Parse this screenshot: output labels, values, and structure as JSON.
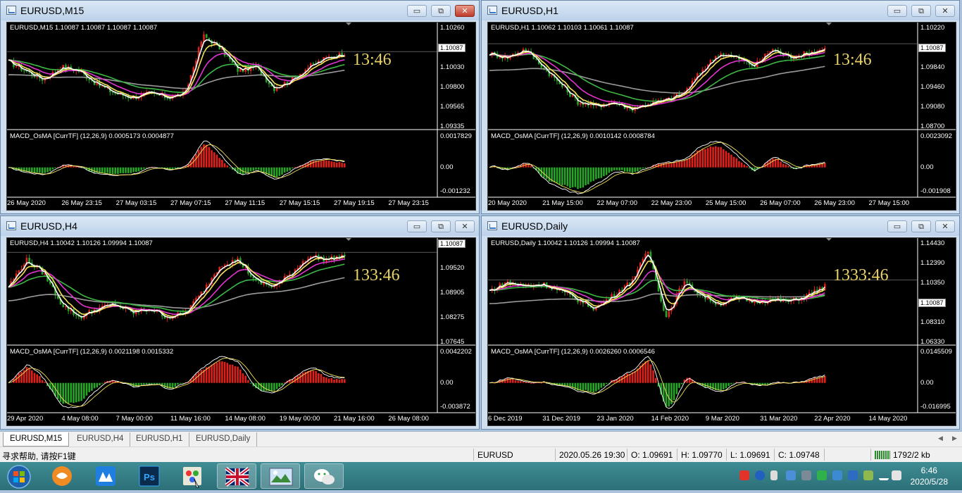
{
  "windows": [
    {
      "title": "EURUSD,M15",
      "ohlc": "EURUSD,M15  1.10087 1.10087 1.10087 1.10087",
      "clock": "13:46",
      "yticks": [
        "1.10260",
        "1.10087",
        "1.10030",
        "1.09800",
        "1.09565",
        "1.09335"
      ],
      "price_tag": "1.10087",
      "macd": "MACD_OsMA [CurrTF] (12,26,9) 0.0005173 0.0004877",
      "macd_ticks": [
        "0.0017829",
        "0.00",
        "-0.001232"
      ],
      "xticks": [
        "26 May 2020",
        "26 May 23:15",
        "27 May 03:15",
        "27 May 07:15",
        "27 May 11:15",
        "27 May 15:15",
        "27 May 19:15",
        "27 May 23:15"
      ]
    },
    {
      "title": "EURUSD,H1",
      "ohlc": "EURUSD,H1  1.10062 1.10103 1.10061 1.10087",
      "clock": "13:46",
      "yticks": [
        "1.10220",
        "1.10087",
        "1.09840",
        "1.09460",
        "1.09080",
        "1.08700"
      ],
      "price_tag": "1.10087",
      "macd": "MACD_OsMA [CurrTF] (12,26,9) 0.0010142 0.0008784",
      "macd_ticks": [
        "0.0023092",
        "0.00",
        "-0.001908"
      ],
      "xticks": [
        "20 May 2020",
        "21 May 15:00",
        "22 May 07:00",
        "22 May 23:00",
        "25 May 15:00",
        "26 May 07:00",
        "26 May 23:00",
        "27 May 15:00"
      ]
    },
    {
      "title": "EURUSD,H4",
      "ohlc": "EURUSD,H4  1.10042 1.10126 1.09994 1.10087",
      "clock": "133:46",
      "yticks": [
        "1.10087",
        "1.09520",
        "1.08905",
        "1.08275",
        "1.07645"
      ],
      "price_tag": "1.10087",
      "macd": "MACD_OsMA [CurrTF] (12,26,9) 0.0021198 0.0015332",
      "macd_ticks": [
        "0.0042202",
        "0.00",
        "-0.003872"
      ],
      "xticks": [
        "29 Apr 2020",
        "4 May 08:00",
        "7 May 00:00",
        "11 May 16:00",
        "14 May 08:00",
        "19 May 00:00",
        "21 May 16:00",
        "26 May 08:00"
      ]
    },
    {
      "title": "EURUSD,Daily",
      "ohlc": "EURUSD,Daily  1.10042 1.10126 1.09994 1.10087",
      "clock": "1333:46",
      "yticks": [
        "1.14430",
        "1.12390",
        "1.10350",
        "1.10087",
        "1.08310",
        "1.06330"
      ],
      "price_tag": "1.10087",
      "macd": "MACD_OsMA [CurrTF] (12,26,9) 0.0026260 0.0006546",
      "macd_ticks": [
        "0.0145509",
        "0.00",
        "-0.016995"
      ],
      "xticks": [
        "6 Dec 2019",
        "31 Dec 2019",
        "23 Jan 2020",
        "14 Feb 2020",
        "9 Mar 2020",
        "31 Mar 2020",
        "22 Apr 2020",
        "14 May 2020"
      ]
    }
  ],
  "win_buttons": {
    "min": "▭",
    "max": "⧉",
    "close": "✕"
  },
  "tabs": [
    "EURUSD,M15",
    "EURUSD,H4",
    "EURUSD,H1",
    "EURUSD,Daily"
  ],
  "status": {
    "help": "寻求帮助, 请按F1键",
    "profile": "EURUSD",
    "datetime": "2020.05.26 19:30",
    "open": "O: 1.09691",
    "high": "H: 1.09770",
    "low": "L: 1.09691",
    "close": "C: 1.09748",
    "traffic": "1792/2 kb"
  },
  "taskbar": {
    "apps": [
      "start-orb",
      "foxmail",
      "app-blue",
      "photoshop",
      "paint",
      "mt4",
      "photo-viewer",
      "wechat"
    ],
    "time": "6:46",
    "date": "2020/5/28"
  },
  "colors": {
    "bull": "#e0201a",
    "bear": "#27a627",
    "ma_yellow": "#f5e35a",
    "ma_white": "#ffffff",
    "ma_magenta": "#e234d0",
    "ma_green": "#3cb844",
    "ma_gray": "#9a9a9a",
    "clock": "#e8d266"
  }
}
